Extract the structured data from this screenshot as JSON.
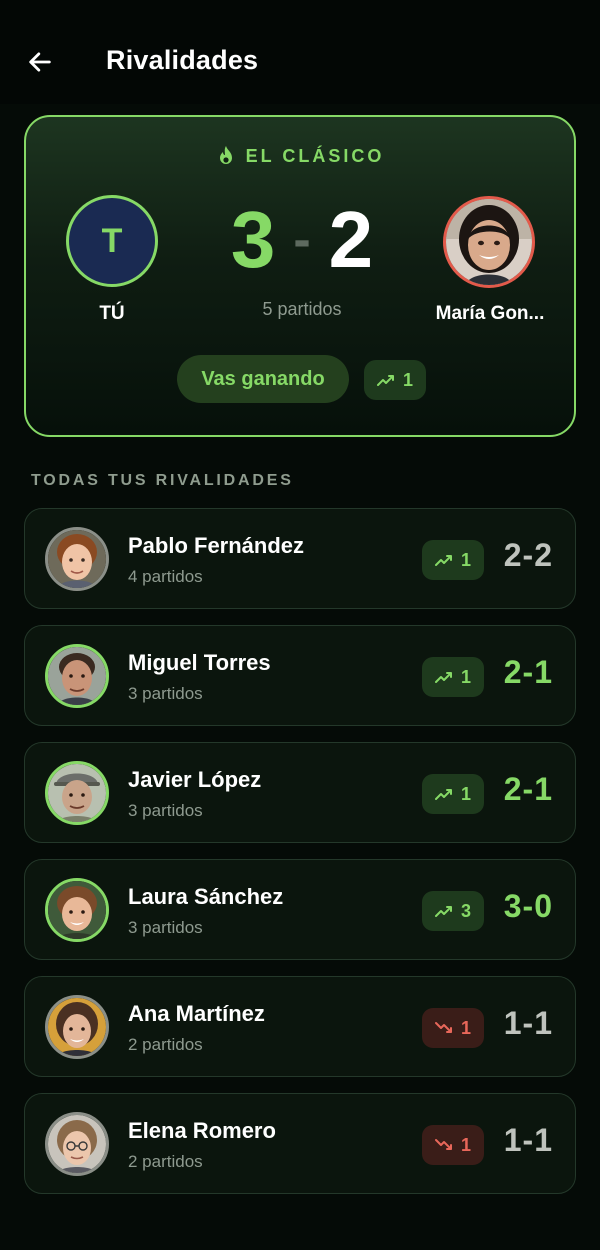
{
  "header": {
    "title": "Rivalidades",
    "back_icon": "arrow-left-icon"
  },
  "featured": {
    "tag_icon": "flame-icon",
    "tag": "EL CLÁSICO",
    "you": {
      "initial": "T",
      "name": "TÚ"
    },
    "opponent": {
      "name": "María Gon..."
    },
    "score_me": "3",
    "score_sep": "-",
    "score_opp": "2",
    "matches": "5 partidos",
    "status": "Vas ganando",
    "streak": "1",
    "streak_icon": "trend-up-icon"
  },
  "section_label": "TODAS TUS RIVALIDADES",
  "colors": {
    "accent": "#86d966",
    "loss": "#e8675a",
    "background": "#050b07",
    "card": "#0b150d"
  },
  "rivals": [
    {
      "name": "Pablo Fernández",
      "matches": "4 partidos",
      "trend": "up",
      "trend_value": "1",
      "score": "2-2",
      "result": "tie"
    },
    {
      "name": "Miguel Torres",
      "matches": "3 partidos",
      "trend": "up",
      "trend_value": "1",
      "score": "2-1",
      "result": "win"
    },
    {
      "name": "Javier López",
      "matches": "3 partidos",
      "trend": "up",
      "trend_value": "1",
      "score": "2-1",
      "result": "win"
    },
    {
      "name": "Laura Sánchez",
      "matches": "3 partidos",
      "trend": "up",
      "trend_value": "3",
      "score": "3-0",
      "result": "win"
    },
    {
      "name": "Ana Martínez",
      "matches": "2 partidos",
      "trend": "down",
      "trend_value": "1",
      "score": "1-1",
      "result": "tie"
    },
    {
      "name": "Elena Romero",
      "matches": "2 partidos",
      "trend": "down",
      "trend_value": "1",
      "score": "1-1",
      "result": "tie"
    }
  ]
}
